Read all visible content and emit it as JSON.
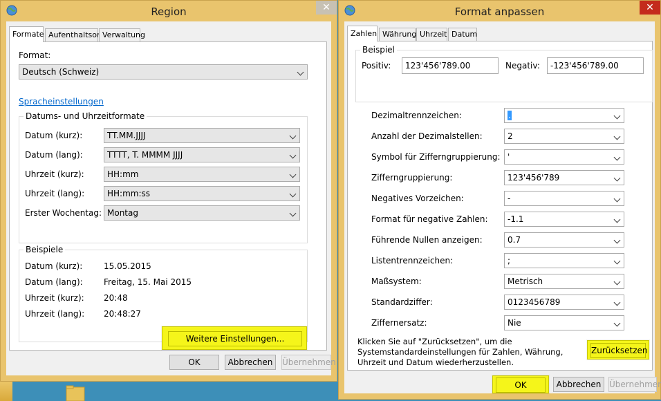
{
  "region": {
    "title": "Region",
    "tabs": [
      "Formate",
      "Aufenthaltsort",
      "Verwaltung"
    ],
    "format_label": "Format:",
    "format_value": "Deutsch (Schweiz)",
    "language_link": "Spracheinstellungen",
    "date_group_title": "Datums- und Uhrzeitformate",
    "fields": [
      {
        "label": "Datum (kurz):",
        "value": "TT.MM.JJJJ"
      },
      {
        "label": "Datum (lang):",
        "value": "TTTT, T. MMMM JJJJ"
      },
      {
        "label": "Uhrzeit (kurz):",
        "value": "HH:mm"
      },
      {
        "label": "Uhrzeit (lang):",
        "value": "HH:mm:ss"
      },
      {
        "label": "Erster Wochentag:",
        "value": "Montag"
      }
    ],
    "examples_title": "Beispiele",
    "examples": [
      {
        "label": "Datum (kurz):",
        "value": "15.05.2015"
      },
      {
        "label": "Datum (lang):",
        "value": "Freitag, 15. Mai 2015"
      },
      {
        "label": "Uhrzeit (kurz):",
        "value": "20:48"
      },
      {
        "label": "Uhrzeit (lang):",
        "value": "20:48:27"
      }
    ],
    "more_settings": "Weitere Einstellungen...",
    "ok": "OK",
    "cancel": "Abbrechen",
    "apply": "Übernehmen"
  },
  "format": {
    "title": "Format anpassen",
    "tabs": [
      "Zahlen",
      "Währung",
      "Uhrzeit",
      "Datum"
    ],
    "example_title": "Beispiel",
    "positive_label": "Positiv:",
    "positive_value": "123'456'789.00",
    "negative_label": "Negativ:",
    "negative_value": "-123'456'789.00",
    "settings": [
      {
        "label": "Dezimaltrennzeichen:",
        "value": "."
      },
      {
        "label": "Anzahl der Dezimalstellen:",
        "value": "2"
      },
      {
        "label": "Symbol für Zifferngruppierung:",
        "value": "'"
      },
      {
        "label": "Zifferngruppierung:",
        "value": "123'456'789"
      },
      {
        "label": "Negatives Vorzeichen:",
        "value": "-"
      },
      {
        "label": "Format für negative Zahlen:",
        "value": "-1.1"
      },
      {
        "label": "Führende Nullen anzeigen:",
        "value": "0.7"
      },
      {
        "label": "Listentrennzeichen:",
        "value": ";"
      },
      {
        "label": "Maßsystem:",
        "value": "Metrisch"
      },
      {
        "label": "Standardziffer:",
        "value": "0123456789"
      },
      {
        "label": "Ziffernersatz:",
        "value": "Nie"
      }
    ],
    "reset_text": "Klicken Sie auf \"Zurücksetzen\", um die Systemstandardeinstellungen für Zahlen, Währung, Uhrzeit und Datum wiederherzustellen.",
    "reset_button": "Zurücksetzen",
    "ok": "OK",
    "cancel": "Abbrechen",
    "apply": "Übernehmen"
  },
  "colors": {
    "highlight": "#f5f51a",
    "frame": "#e9c46d",
    "link": "#0066cc"
  }
}
